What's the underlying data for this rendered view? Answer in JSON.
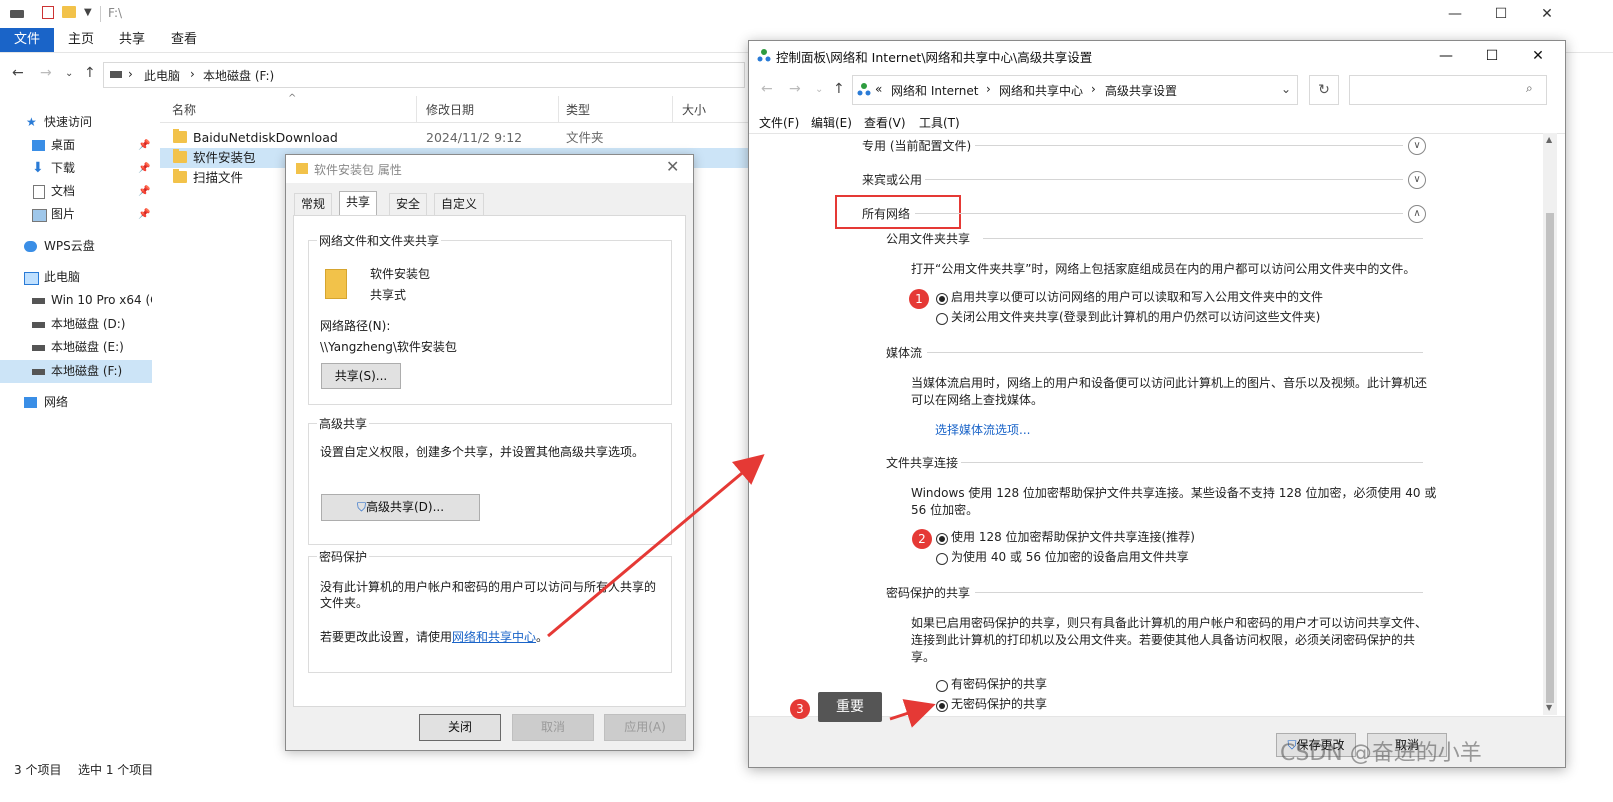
{
  "explorer": {
    "title": "F:\\",
    "window_buttons": {
      "min": "—",
      "max": "☐",
      "close": "✕"
    },
    "ribbon_tabs": [
      "文件",
      "主页",
      "共享",
      "查看"
    ],
    "address": {
      "crumbs": [
        "此电脑",
        "本地磁盘 (F:)"
      ],
      "sep": "›"
    },
    "nav": [
      {
        "label": "快速访问",
        "icon": "star-icon"
      },
      {
        "label": "桌面",
        "icon": "desktop-icon",
        "pinned": true
      },
      {
        "label": "下载",
        "icon": "download-icon",
        "pinned": true
      },
      {
        "label": "文档",
        "icon": "document-icon",
        "pinned": true
      },
      {
        "label": "图片",
        "icon": "picture-icon",
        "pinned": true
      },
      {
        "label": "WPS云盘",
        "icon": "cloud-icon"
      },
      {
        "label": "此电脑",
        "icon": "computer-icon"
      },
      {
        "label": "Win 10 Pro x64 (C",
        "icon": "drive-icon"
      },
      {
        "label": "本地磁盘 (D:)",
        "icon": "drive-icon"
      },
      {
        "label": "本地磁盘 (E:)",
        "icon": "drive-icon"
      },
      {
        "label": "本地磁盘 (F:)",
        "icon": "drive-icon",
        "selected": true
      },
      {
        "label": "网络",
        "icon": "network-icon"
      }
    ],
    "columns": [
      "名称",
      "修改日期",
      "类型",
      "大小"
    ],
    "files": [
      {
        "name": "BaiduNetdiskDownload",
        "date": "2024/11/2 9:12",
        "type": "文件夹"
      },
      {
        "name": "软件安装包",
        "date": "",
        "type": "",
        "selected": true
      },
      {
        "name": "扫描文件",
        "date": "",
        "type": ""
      }
    ],
    "status": {
      "count": "3 个项目",
      "selected": "选中 1 个项目"
    }
  },
  "props": {
    "title": "软件安装包 属性",
    "tabs": [
      "常规",
      "共享",
      "安全",
      "自定义"
    ],
    "active_tab": "共享",
    "net_group": {
      "title": "网络文件和文件夹共享",
      "name": "软件安装包",
      "state": "共享式",
      "path_label": "网络路径(N):",
      "path": "\\\\Yangzheng\\软件安装包",
      "share_btn": "共享(S)..."
    },
    "adv_group": {
      "title": "高级共享",
      "desc": "设置自定义权限，创建多个共享，并设置其他高级共享选项。",
      "btn": "高级共享(D)..."
    },
    "pwd_group": {
      "title": "密码保护",
      "desc": "没有此计算机的用户帐户和密码的用户可以访问与所有人共享的文件夹。",
      "change_prefix": "若要更改此设置，请使用",
      "link": "网络和共享中心",
      "change_suffix": "。"
    },
    "buttons": {
      "close": "关闭",
      "cancel": "取消",
      "apply": "应用(A)"
    }
  },
  "adv": {
    "title": "控制面板\\网络和 Internet\\网络和共享中心\\高级共享设置",
    "window_buttons": {
      "min": "—",
      "max": "☐",
      "close": "✕"
    },
    "breadcrumbs": [
      "«",
      "网络和 Internet",
      "›",
      "网络和共享中心",
      "›",
      "高级共享设置"
    ],
    "menu": [
      "文件(F)",
      "编辑(E)",
      "查看(V)",
      "工具(T)"
    ],
    "sections": {
      "private": "专用 (当前配置文件)",
      "guest": "来宾或公用",
      "all": "所有网络"
    },
    "public_folder": {
      "title": "公用文件夹共享",
      "desc": "打开“公用文件夹共享”时，网络上包括家庭组成员在内的用户都可以访问公用文件夹中的文件。",
      "opt_on": "启用共享以便可以访问网络的用户可以读取和写入公用文件夹中的文件",
      "opt_off": "关闭公用文件夹共享(登录到此计算机的用户仍然可以访问这些文件夹)"
    },
    "media": {
      "title": "媒体流",
      "desc1": "当媒体流启用时，网络上的用户和设备便可以访问此计算机上的图片、音乐以及视频。此计算机还",
      "desc2": "可以在网络上查找媒体。",
      "link": "选择媒体流选项..."
    },
    "file_conn": {
      "title": "文件共享连接",
      "desc1": "Windows 使用 128 位加密帮助保护文件共享连接。某些设备不支持 128 位加密，必须使用 40 或",
      "desc2": "56 位加密。",
      "opt_128": "使用 128 位加密帮助保护文件共享连接(推荐)",
      "opt_40": "为使用 40 或 56 位加密的设备启用文件共享"
    },
    "pwd": {
      "title": "密码保护的共享",
      "desc1": "如果已启用密码保护的共享，则只有具备此计算机的用户帐户和密码的用户才可以访问共享文件、",
      "desc2": "连接到此计算机的打印机以及公用文件夹。若要使其他人具备访问权限，必须关闭密码保护的共",
      "desc3": "享。",
      "opt_on": "有密码保护的共享",
      "opt_off": "无密码保护的共享"
    },
    "annotation": {
      "badge1": "1",
      "badge2": "2",
      "badge3": "3",
      "callout": "重要"
    },
    "buttons": {
      "save": "保存更改",
      "cancel": "取消"
    }
  },
  "watermark": "CSDN @奋进的小羊"
}
